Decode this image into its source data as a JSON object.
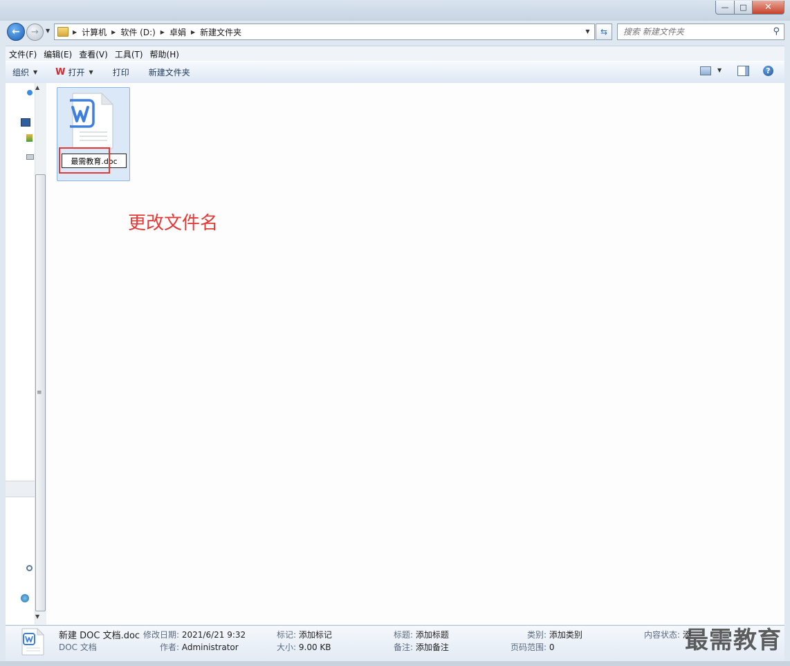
{
  "address": {
    "crumbs": [
      "计算机",
      "软件 (D:)",
      "卓娟",
      "新建文件夹"
    ]
  },
  "search": {
    "placeholder": "搜索 新建文件夹"
  },
  "menu": [
    "文件(F)",
    "编辑(E)",
    "查看(V)",
    "工具(T)",
    "帮助(H)"
  ],
  "toolbar": {
    "organize": "组织",
    "open": "打开",
    "print": "打印",
    "new_folder": "新建文件夹"
  },
  "file": {
    "rename_value": "最需教育.doc"
  },
  "annotation": "更改文件名",
  "details": {
    "file_name": "新建 DOC 文档.doc",
    "file_type": "DOC 文档",
    "modified_label": "修改日期:",
    "modified_value": "2021/6/21 9:32",
    "author_label": "作者:",
    "author_value": "Administrator",
    "tags_label": "标记:",
    "tags_value": "添加标记",
    "size_label": "大小:",
    "size_value": "9.00 KB",
    "title_label": "标题:",
    "title_value": "添加标题",
    "comments_label": "备注:",
    "comments_value": "添加备注",
    "category_label": "类别:",
    "category_value": "添加类别",
    "pages_label": "页码范围:",
    "pages_value": "0",
    "status_label": "内容状态:",
    "status_value": "添"
  },
  "watermark": "最需教育",
  "colors": {
    "highlight": "#e53935",
    "wps_red": "#d4282a",
    "word_blue": "#3d7fe0"
  }
}
